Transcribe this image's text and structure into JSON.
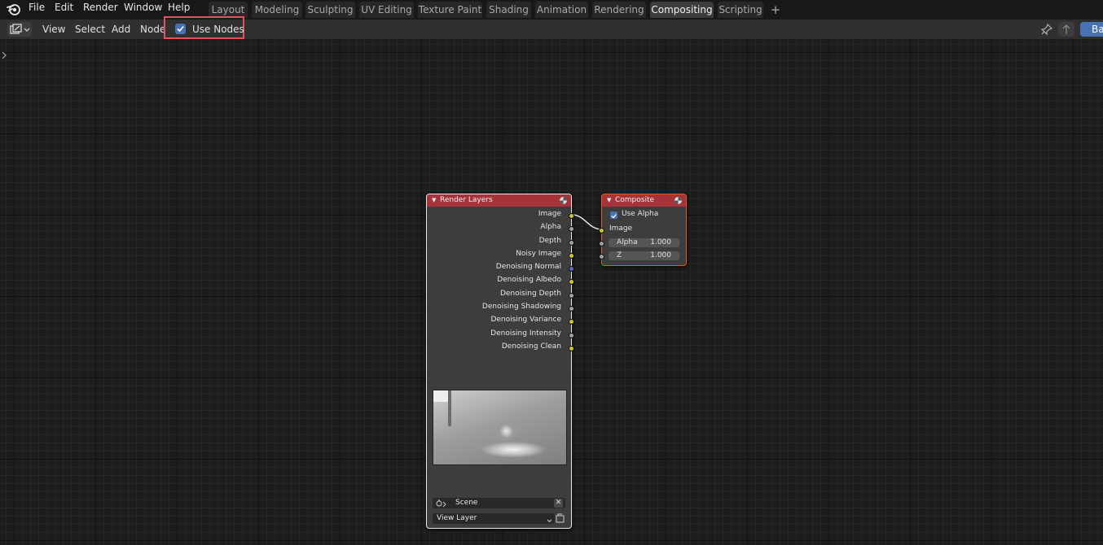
{
  "menu": [
    "File",
    "Edit",
    "Render",
    "Window",
    "Help"
  ],
  "workspaces": [
    {
      "label": "Layout",
      "active": false
    },
    {
      "label": "Modeling",
      "active": false
    },
    {
      "label": "Sculpting",
      "active": false
    },
    {
      "label": "UV Editing",
      "active": false
    },
    {
      "label": "Texture Paint",
      "active": false
    },
    {
      "label": "Shading",
      "active": false
    },
    {
      "label": "Animation",
      "active": false
    },
    {
      "label": "Rendering",
      "active": false
    },
    {
      "label": "Compositing",
      "active": true
    },
    {
      "label": "Scripting",
      "active": false
    }
  ],
  "header": {
    "view": "View",
    "select": "Select",
    "add": "Add",
    "node": "Node",
    "use_nodes": "Use Nodes",
    "use_nodes_checked": true,
    "backdrop": "Ba"
  },
  "render_layers": {
    "title": "Render Layers",
    "outputs": [
      {
        "label": "Image",
        "color": "#c7c729"
      },
      {
        "label": "Alpha",
        "color": "#a1a1a1"
      },
      {
        "label": "Depth",
        "color": "#a1a1a1"
      },
      {
        "label": "Noisy Image",
        "color": "#c7c729"
      },
      {
        "label": "Denoising Normal",
        "color": "#6363c7"
      },
      {
        "label": "Denoising Albedo",
        "color": "#c7c729"
      },
      {
        "label": "Denoising Depth",
        "color": "#a1a1a1"
      },
      {
        "label": "Denoising Shadowing",
        "color": "#a1a1a1"
      },
      {
        "label": "Denoising Variance",
        "color": "#c7c729"
      },
      {
        "label": "Denoising Intensity",
        "color": "#a1a1a1"
      },
      {
        "label": "Denoising Clean",
        "color": "#c7c729"
      }
    ],
    "scene": "Scene",
    "view_layer": "View Layer"
  },
  "composite": {
    "title": "Composite",
    "use_alpha": "Use Alpha",
    "use_alpha_checked": true,
    "image_label": "Image",
    "alpha_label": "Alpha",
    "alpha_value": "1.000",
    "z_label": "Z",
    "z_value": "1.000"
  }
}
